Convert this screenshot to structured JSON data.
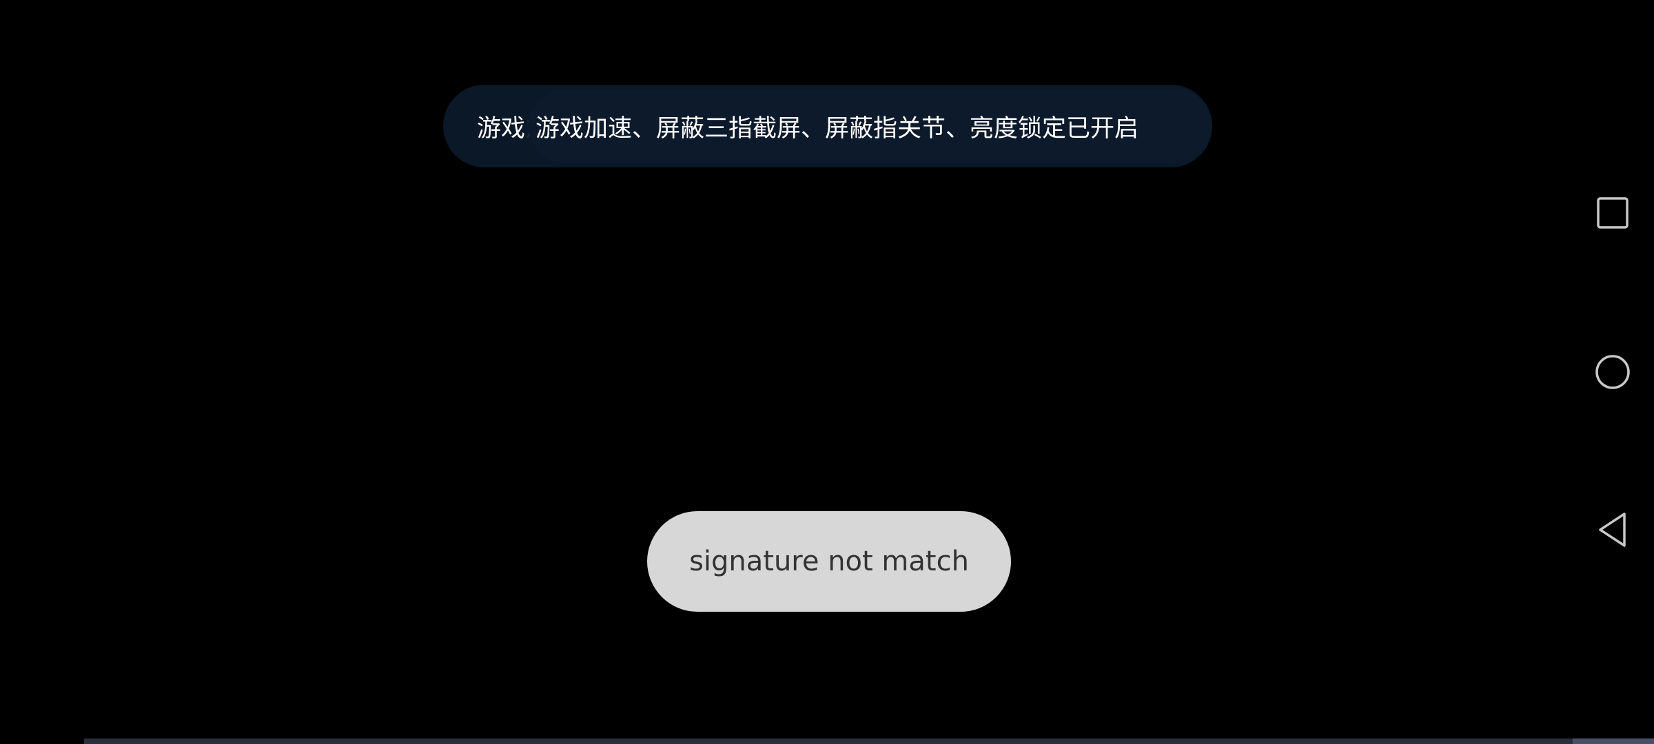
{
  "banner": {
    "title": "游戏",
    "ghost_text": "加",
    "message": "游戏加速、屏蔽三指截屏、屏蔽指关节、亮度锁定已开启"
  },
  "toast": {
    "message": "signature not match"
  },
  "navigation": {
    "recent_icon": "square-icon",
    "home_icon": "circle-icon",
    "back_icon": "triangle-back-icon"
  },
  "colors": {
    "background": "#000000",
    "banner_bg": "#0b1828",
    "toast_bg": "#d7d7d7",
    "toast_text": "#333333",
    "nav_icon": "#c8c8c8"
  }
}
